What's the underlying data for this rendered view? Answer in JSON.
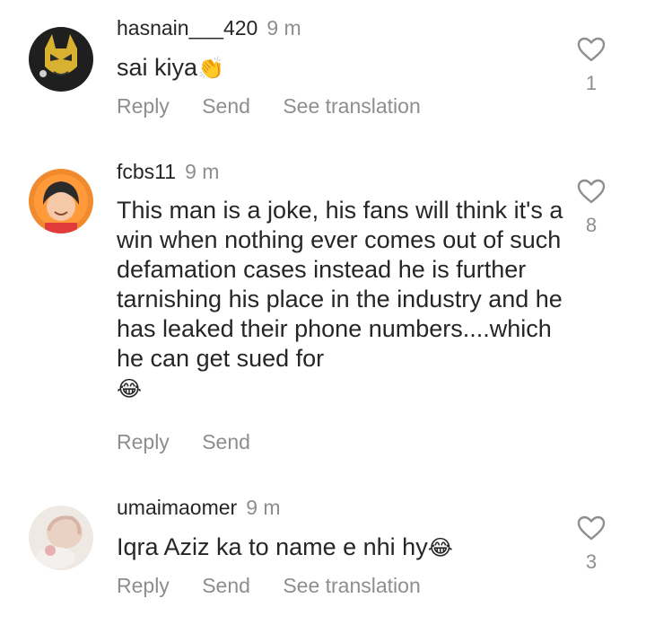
{
  "comments": [
    {
      "username": "hasnain___420",
      "time": "9 m",
      "text": "sai kiya",
      "emoji": "👏",
      "actions": [
        "Reply",
        "Send",
        "See translation"
      ],
      "likes": "1"
    },
    {
      "username": "fcbs11",
      "time": "9 m",
      "text": "This man is a joke, his fans will think it's a win when nothing ever comes out of such defamation cases instead he is further tarnishing his place in the industry and he has leaked their phone numbers....which he can get sued for",
      "emoji": "😂",
      "actions": [
        "Reply",
        "Send"
      ],
      "likes": "8"
    },
    {
      "username": "umaimaomer",
      "time": "9 m",
      "text": "Iqra Aziz ka to name e nhi hy",
      "emoji": "😂",
      "actions": [
        "Reply",
        "Send",
        "See translation"
      ],
      "likes": "3"
    }
  ]
}
